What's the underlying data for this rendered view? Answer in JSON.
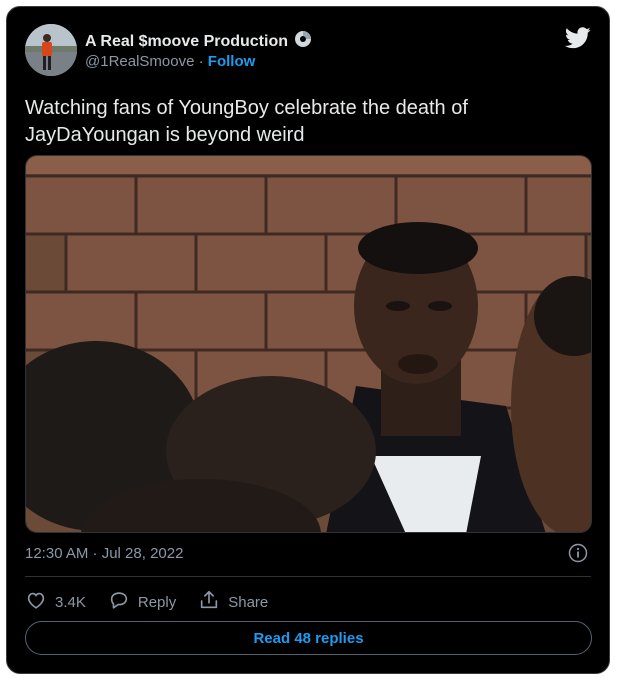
{
  "author": {
    "display_name": "A Real $moove Production",
    "handle": "@1RealSmoove",
    "separator": "·",
    "follow_label": "Follow"
  },
  "tweet": {
    "text": "Watching fans of YoungBoy celebrate the death of JayDaYoungan is beyond weird",
    "timestamp": "12:30 AM · Jul 28, 2022"
  },
  "actions": {
    "likes_count": "3.4K",
    "reply_label": "Reply",
    "share_label": "Share"
  },
  "footer": {
    "read_replies_label": "Read 48 replies"
  },
  "icons": {
    "platform": "twitter-bird-icon",
    "badge": "disc-badge-icon",
    "info": "info-icon",
    "like": "heart-icon",
    "reply": "reply-bubble-icon",
    "share": "share-icon"
  },
  "colors": {
    "background": "#000000",
    "primary_text": "#e7e9ea",
    "secondary_text": "#8b98a5",
    "accent": "#1d9bf0"
  }
}
